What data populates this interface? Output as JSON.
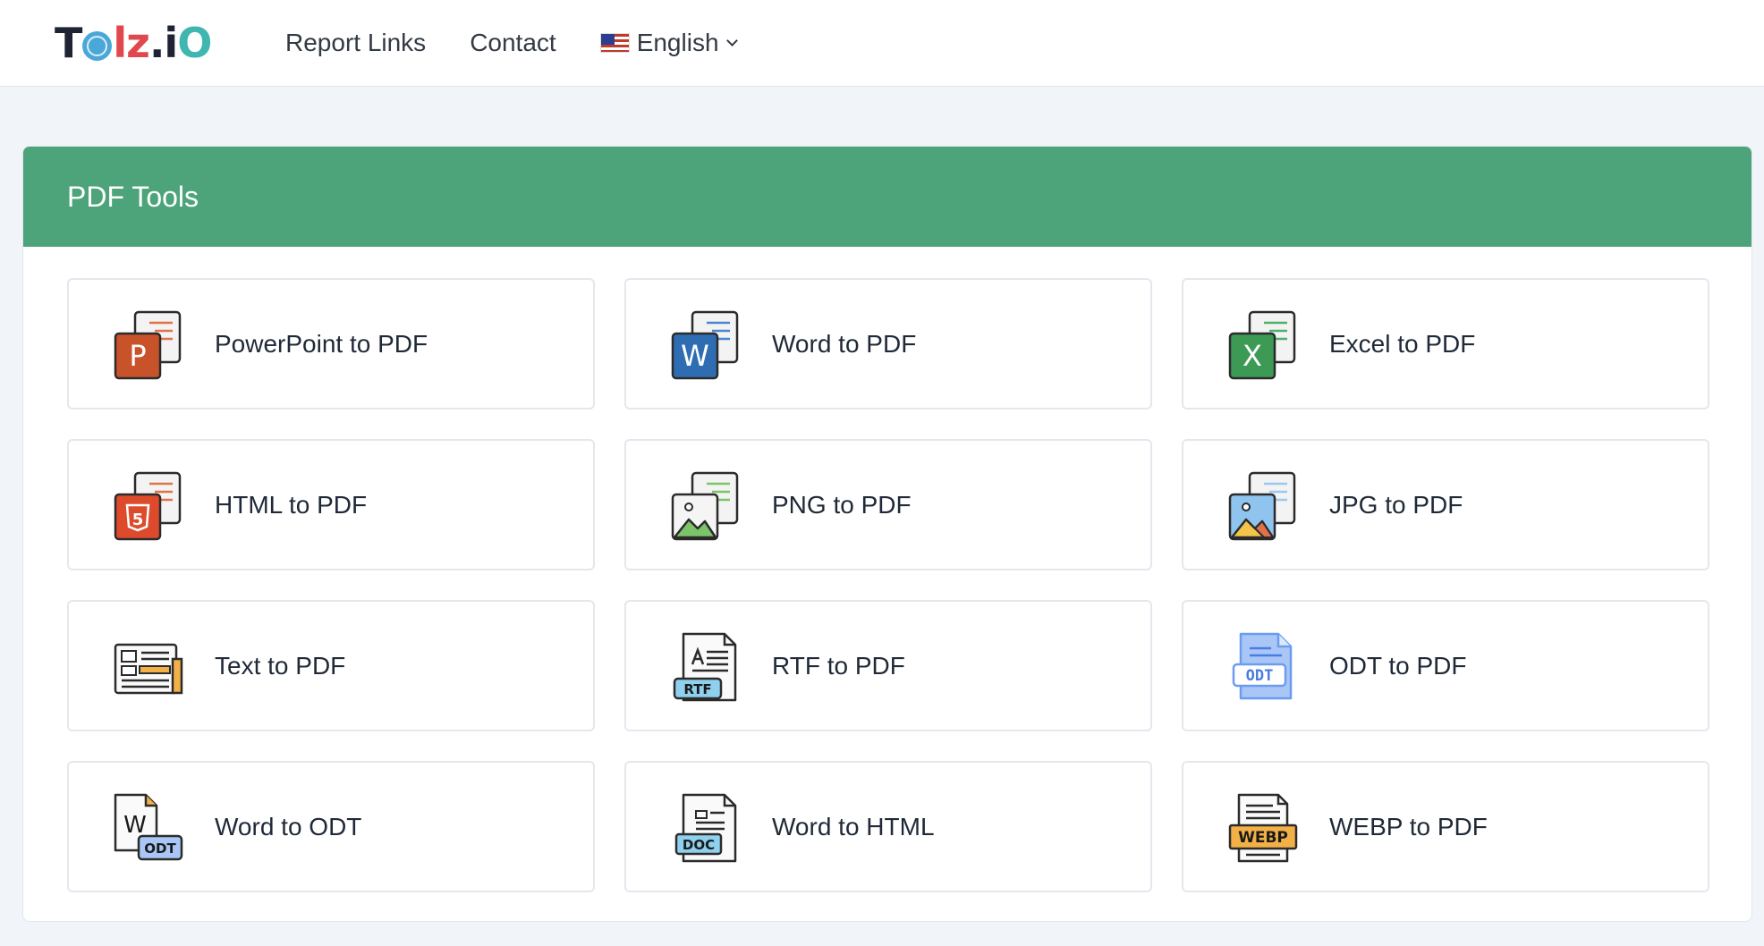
{
  "brand": {
    "parts": [
      "T",
      "lz",
      ".i",
      "O"
    ]
  },
  "nav": {
    "links": [
      "Report Links",
      "Contact"
    ],
    "language": "English"
  },
  "section": {
    "title": "PDF Tools"
  },
  "tools": [
    {
      "label": "PowerPoint to PDF",
      "icon": "powerpoint-icon"
    },
    {
      "label": "Word to PDF",
      "icon": "word-icon"
    },
    {
      "label": "Excel to PDF",
      "icon": "excel-icon"
    },
    {
      "label": "HTML to PDF",
      "icon": "html-icon"
    },
    {
      "label": "PNG to PDF",
      "icon": "png-icon"
    },
    {
      "label": "JPG to PDF",
      "icon": "jpg-icon"
    },
    {
      "label": "Text to PDF",
      "icon": "text-icon"
    },
    {
      "label": "RTF to PDF",
      "icon": "rtf-icon"
    },
    {
      "label": "ODT to PDF",
      "icon": "odt-icon"
    },
    {
      "label": "Word to ODT",
      "icon": "word-odt-icon"
    },
    {
      "label": "Word to HTML",
      "icon": "word-html-icon"
    },
    {
      "label": "WEBP to PDF",
      "icon": "webp-icon"
    }
  ],
  "icon_text": {
    "ppt": "P",
    "word": "W",
    "excel": "X",
    "html5": "5",
    "rtf": "RTF",
    "odt": "ODT",
    "word_w": "W",
    "odt_small": "ODT",
    "doc": "DOC",
    "webp": "WEBP"
  },
  "colors": {
    "header_green": "#4ea47a",
    "powerpoint": "#c8522a",
    "word": "#2f6db3",
    "excel": "#3c9a55",
    "html": "#dd4b2c",
    "odt_blue": "#6b9cf0"
  }
}
